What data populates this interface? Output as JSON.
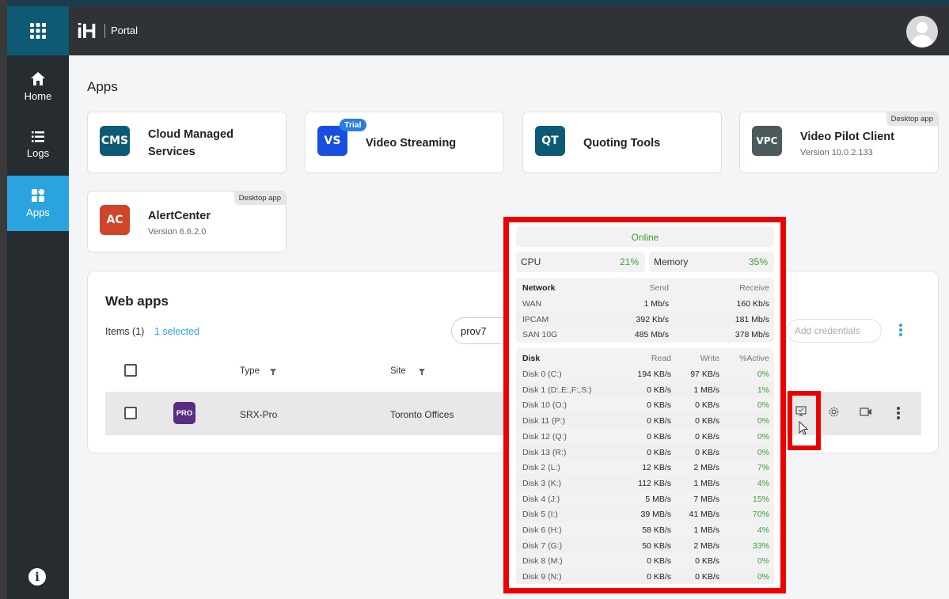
{
  "header": {
    "logo": "iH",
    "portal_label": "Portal"
  },
  "sidebar": {
    "items": [
      {
        "label": "Home",
        "icon": "home-icon"
      },
      {
        "label": "Logs",
        "icon": "list-icon"
      },
      {
        "label": "Apps",
        "icon": "apps-icon"
      }
    ]
  },
  "apps": {
    "title": "Apps",
    "cards": [
      {
        "name": "Cloud Managed Services",
        "name_line1": "Cloud Managed",
        "name_line2": "Services",
        "icon_text": "CMS",
        "color": "#0e5a75"
      },
      {
        "name": "Video Streaming",
        "icon_text": "VS",
        "badge": "Trial",
        "color": "#1a4ee0"
      },
      {
        "name": "Quoting Tools",
        "icon_text": "QT",
        "color": "#0e5a75"
      },
      {
        "name": "Video Pilot Client",
        "version": "Version 10.0.2.133",
        "icon_text": "VPC",
        "badge": "Desktop app",
        "color": "#4b5a5c"
      },
      {
        "name": "AlertCenter",
        "version": "Version 6.6.2.0",
        "icon_text": "AC",
        "badge": "Desktop app",
        "color": "#cf4527"
      }
    ]
  },
  "web_apps": {
    "title": "Web apps",
    "items_count": "Items (1)",
    "selected": "1 selected",
    "search_value": "prov7",
    "add_credentials": "Add credentials",
    "columns": {
      "type": "Type",
      "site": "Site"
    },
    "rows": [
      {
        "icon_text": "PRO",
        "type": "SRX-Pro",
        "site": "Toronto Offices"
      }
    ]
  },
  "popup": {
    "status": "Online",
    "cpu_label": "CPU",
    "cpu_value": "21%",
    "memory_label": "Memory",
    "memory_value": "35%",
    "network": {
      "header": [
        "Network",
        "Send",
        "Receive"
      ],
      "rows": [
        [
          "WAN",
          "1 Mb/s",
          "160 Kb/s"
        ],
        [
          "IPCAM",
          "392 Kb/s",
          "181 Mb/s"
        ],
        [
          "SAN 10G",
          "485 Mb/s",
          "378 Mb/s"
        ]
      ]
    },
    "disk": {
      "header": [
        "Disk",
        "Read",
        "Write",
        "%Active"
      ],
      "rows": [
        [
          "Disk 0 (C:)",
          "194 KB/s",
          "97 KB/s",
          "0%"
        ],
        [
          "Disk 1 (D:,E:,F:,S:)",
          "0 KB/s",
          "1 MB/s",
          "1%"
        ],
        [
          "Disk 10 (O:)",
          "0 KB/s",
          "0 KB/s",
          "0%"
        ],
        [
          "Disk 11 (P:)",
          "0 KB/s",
          "0 KB/s",
          "0%"
        ],
        [
          "Disk 12 (Q:)",
          "0 KB/s",
          "0 KB/s",
          "0%"
        ],
        [
          "Disk 13 (R:)",
          "0 KB/s",
          "0 KB/s",
          "0%"
        ],
        [
          "Disk 2 (L:)",
          "12 KB/s",
          "2 MB/s",
          "7%"
        ],
        [
          "Disk 3 (K:)",
          "112 KB/s",
          "1 MB/s",
          "4%"
        ],
        [
          "Disk 4 (J:)",
          "5 MB/s",
          "7 MB/s",
          "15%"
        ],
        [
          "Disk 5 (I:)",
          "39 MB/s",
          "41 MB/s",
          "70%"
        ],
        [
          "Disk 6 (H:)",
          "58 KB/s",
          "1 MB/s",
          "4%"
        ],
        [
          "Disk 7 (G:)",
          "50 KB/s",
          "2 MB/s",
          "33%"
        ],
        [
          "Disk 8 (M:)",
          "0 KB/s",
          "0 KB/s",
          "0%"
        ],
        [
          "Disk 9 (N:)",
          "0 KB/s",
          "0 KB/s",
          "0%"
        ]
      ]
    }
  },
  "colors": {
    "accent": "#2aa4df",
    "online": "#3a9f3a",
    "highlight": "#ec0000"
  }
}
